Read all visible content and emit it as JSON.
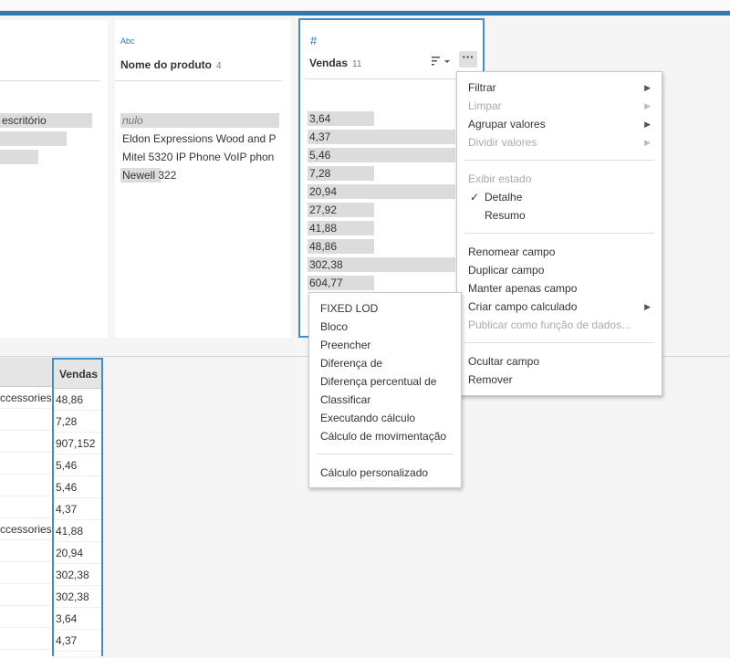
{
  "profile": {
    "left_card": {
      "values": [
        {
          "text": "escritório",
          "bar": 1.0
        },
        {
          "text": "",
          "bar": 0.72
        },
        {
          "text": "",
          "bar": 0.42
        }
      ]
    },
    "nome_card": {
      "type_label": "Abc",
      "title": "Nome do produto",
      "count": "4",
      "values": [
        {
          "text": "nulo",
          "bar": 1.0,
          "null": true
        },
        {
          "text": "Eldon Expressions Wood and P",
          "bar": 0
        },
        {
          "text": "Mitel 5320 IP Phone VoIP phon",
          "bar": 0
        },
        {
          "text": "Newell 322",
          "bar": 0.25
        }
      ]
    },
    "vendas_card": {
      "type_label": "#",
      "title": "Vendas",
      "count": "11",
      "more_label": "···",
      "values": [
        {
          "text": "3,64",
          "bar": 0.45
        },
        {
          "text": "4,37",
          "bar": 1.0
        },
        {
          "text": "5,46",
          "bar": 1.0
        },
        {
          "text": "7,28",
          "bar": 0.45
        },
        {
          "text": "20,94",
          "bar": 1.0
        },
        {
          "text": "27,92",
          "bar": 0.45
        },
        {
          "text": "41,88",
          "bar": 0.45
        },
        {
          "text": "48,86",
          "bar": 0.45
        },
        {
          "text": "302,38",
          "bar": 1.0
        },
        {
          "text": "604,77",
          "bar": 0.45
        }
      ]
    }
  },
  "grid": {
    "left_col": {
      "header": "",
      "cells": [
        "ccessories,",
        "",
        "",
        "",
        "",
        "",
        "ccessories,",
        "",
        "",
        "",
        "",
        ""
      ]
    },
    "vendas_col": {
      "header": "Vendas",
      "cells": [
        "48,86",
        "7,28",
        "907,152",
        "5,46",
        "5,46",
        "4,37",
        "41,88",
        "20,94",
        "302,38",
        "302,38",
        "3,64",
        "4,37"
      ]
    }
  },
  "context_menu": {
    "groups": [
      [
        {
          "label": "Filtrar",
          "submenu": true,
          "disabled": false
        },
        {
          "label": "Limpar",
          "submenu": true,
          "disabled": true
        },
        {
          "label": "Agrupar valores",
          "submenu": true,
          "disabled": false
        },
        {
          "label": "Dividir valores",
          "submenu": true,
          "disabled": true
        }
      ],
      [
        {
          "label": "Exibir estado",
          "disabled": true
        },
        {
          "label": "Detalhe",
          "checked": true
        },
        {
          "label": "Resumo",
          "indent": true
        }
      ],
      [
        {
          "label": "Renomear campo"
        },
        {
          "label": "Duplicar campo"
        },
        {
          "label": "Manter apenas campo"
        },
        {
          "label": "Criar campo calculado",
          "submenu": true
        },
        {
          "label": "Publicar como função de dados...",
          "disabled": true
        }
      ],
      [
        {
          "label": "Ocultar campo"
        },
        {
          "label": "Remover"
        }
      ]
    ]
  },
  "submenu": {
    "items": [
      "FIXED LOD",
      "Bloco",
      "Preencher",
      "Diferença de",
      "Diferença percentual de",
      "Classificar",
      "Executando cálculo",
      "Cálculo de movimentação"
    ],
    "footer_items": [
      "Cálculo personalizado"
    ]
  },
  "colors": {
    "accent": "#2f7ba6",
    "selection_border": "#3d8fd1",
    "bar": "#dcdcdc"
  },
  "icons": {
    "checkmark": "✓",
    "submenu_arrow": "▶",
    "sort": "sort-icon"
  }
}
